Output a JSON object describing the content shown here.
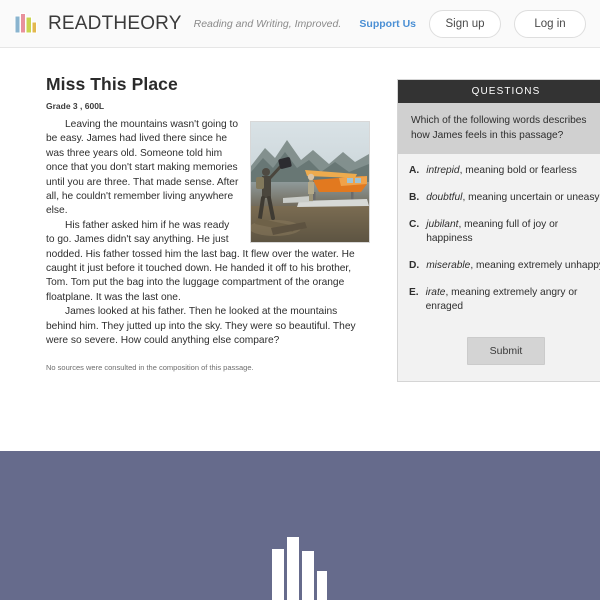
{
  "header": {
    "brand_lead": "READ",
    "brand_rest": "THEORY",
    "tagline": "Reading and Writing, Improved.",
    "support_label": "Support Us",
    "signup_label": "Sign up",
    "login_label": "Log in",
    "logo_colors": [
      "#e8919c",
      "#8ab4cf",
      "#c9d44f",
      "#e3b84f"
    ],
    "link_color": "#4a8fd4"
  },
  "passage": {
    "title": "Miss This Place",
    "meta": "Grade 3 , 600L",
    "paragraphs": [
      "Leaving the mountains wasn't going to be easy. James had lived there since he was three years old. Someone told him once that you don't start making memories until you are three. That made sense. After all, he couldn't remember living anywhere else.",
      "His father asked him if he was ready to go. James didn't say anything. He just nodded. His father tossed him the last bag. It flew over the water. He caught it just before it touched down. He handed it off to his brother, Tom. Tom put the bag into the luggage compartment of the orange floatplane. It was the last one.",
      "James looked at his father. Then he looked at the mountains behind him. They jutted up into the sky. They were so beautiful. They were so severe. How could anything else compare?"
    ],
    "image_alt": "photo of people loading an orange floatplane on a lake shore with mountains",
    "sources_note": "No sources were consulted in the composition of this passage."
  },
  "questions_panel": {
    "header_label": "QUESTIONS",
    "stem": "Which of the following words describes how James feels in this passage?",
    "options": [
      {
        "letter": "A.",
        "word": "intrepid",
        "rest": ", meaning bold or fearless"
      },
      {
        "letter": "B.",
        "word": "doubtful",
        "rest": ", meaning uncertain or uneasy"
      },
      {
        "letter": "C.",
        "word": "jubilant",
        "rest": ", meaning full of joy or happiness"
      },
      {
        "letter": "D.",
        "word": "miserable",
        "rest": ", meaning extremely unhappy"
      },
      {
        "letter": "E.",
        "word": "irate",
        "rest": ", meaning extremely angry or enraged"
      }
    ],
    "submit_label": "Submit",
    "header_bg": "#333333",
    "stem_bg": "#d0d0d0",
    "options_bg": "#f2f2f2"
  },
  "footer": {
    "background": "#666b8c",
    "logo_bar_color": "#ffffff"
  }
}
